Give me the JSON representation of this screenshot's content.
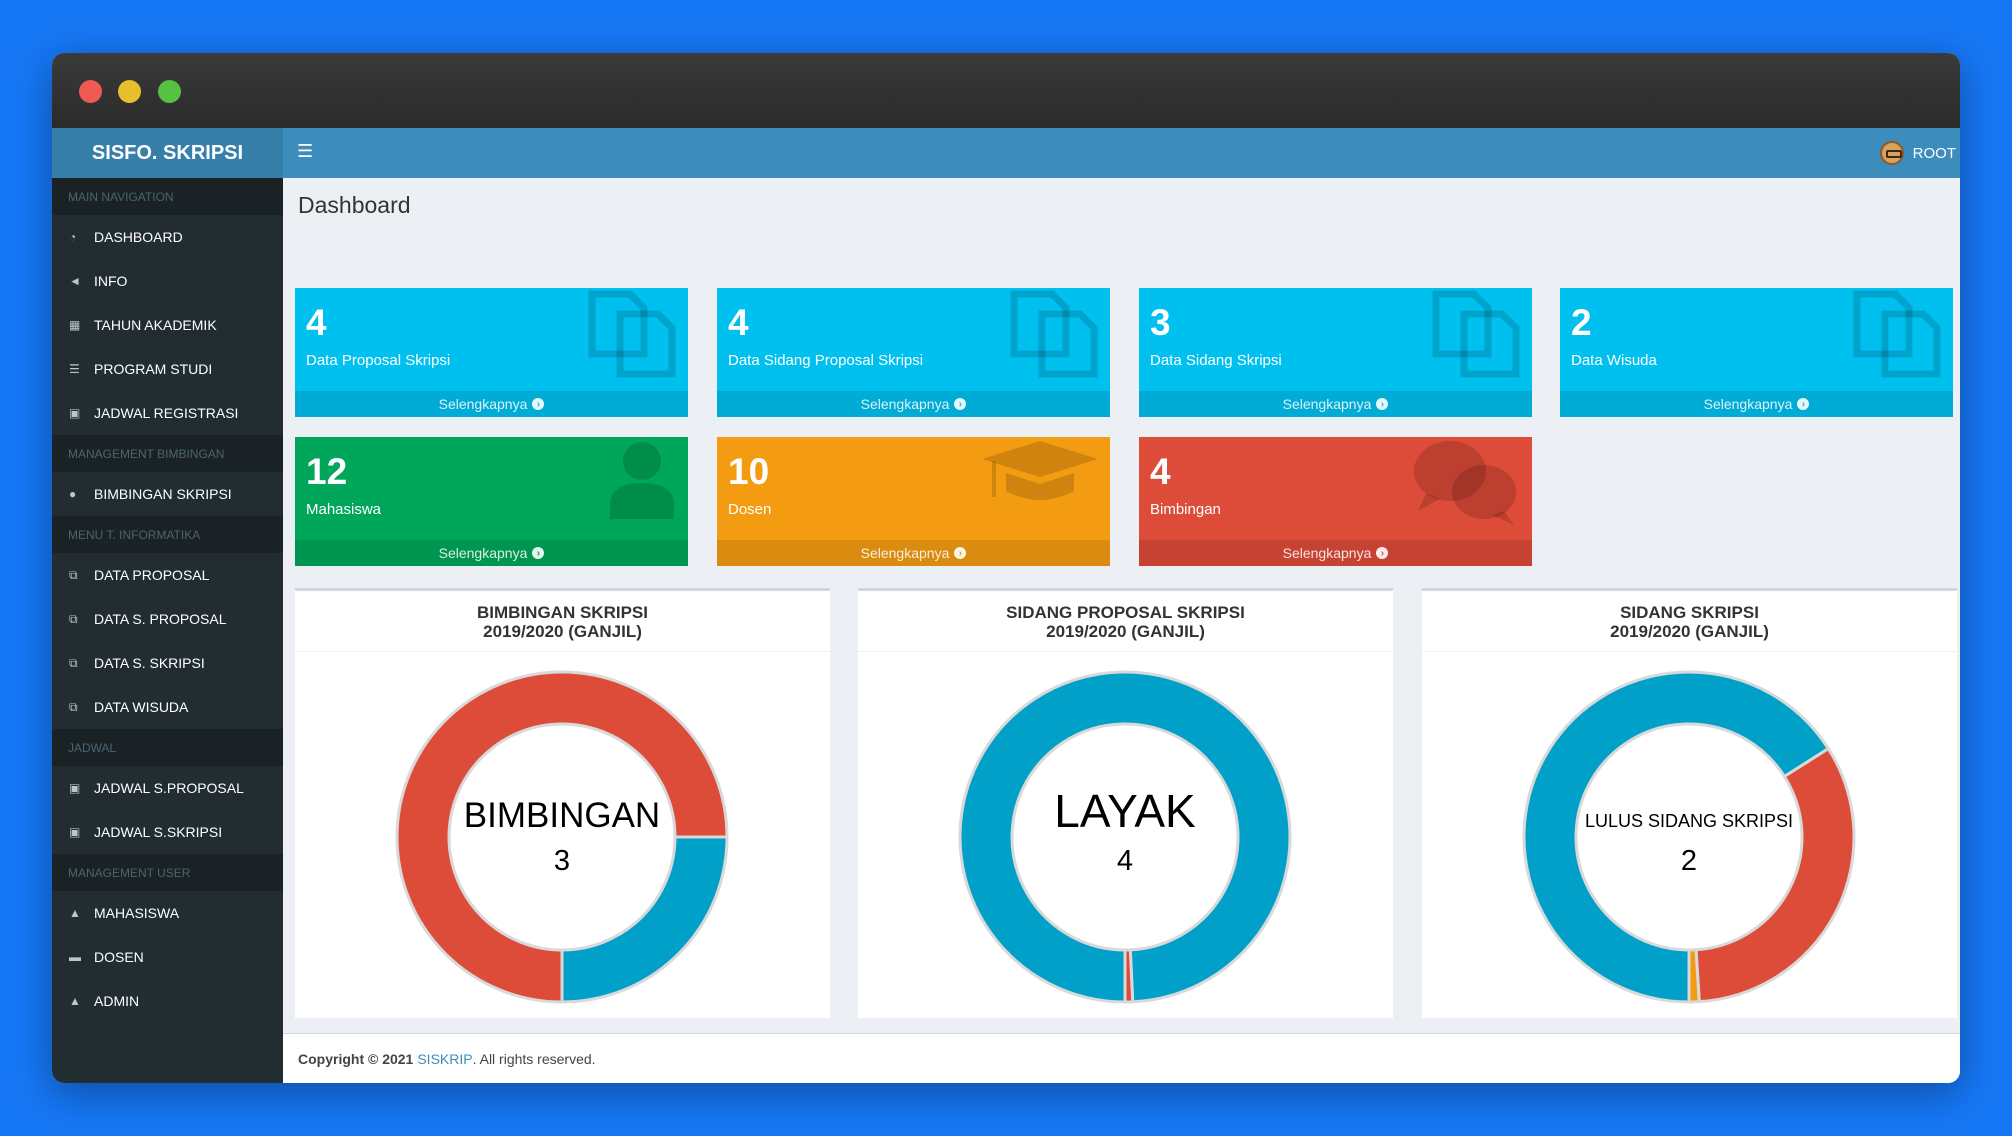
{
  "brand": "SISFO. SKRIPSI",
  "user": "ROOT",
  "page_title": "Dashboard",
  "sidebar": {
    "sections": [
      {
        "header": "MAIN NAVIGATION",
        "items": [
          {
            "label": "DASHBOARD",
            "icon": "dashboard-icon"
          },
          {
            "label": "INFO",
            "icon": "bullhorn-icon"
          },
          {
            "label": "TAHUN AKADEMIK",
            "icon": "calendar-icon"
          },
          {
            "label": "PROGRAM STUDI",
            "icon": "list-icon"
          },
          {
            "label": "JADWAL REGISTRASI",
            "icon": "calendar-plus-icon"
          }
        ]
      },
      {
        "header": "MANAGEMENT BIMBINGAN",
        "items": [
          {
            "label": "BIMBINGAN SKRIPSI",
            "icon": "comments-icon"
          }
        ]
      },
      {
        "header": "MENU T. INFORMATIKA",
        "items": [
          {
            "label": "DATA PROPOSAL",
            "icon": "copy-icon"
          },
          {
            "label": "DATA S. PROPOSAL",
            "icon": "copy-icon"
          },
          {
            "label": "DATA S. SKRIPSI",
            "icon": "copy-icon"
          },
          {
            "label": "DATA WISUDA",
            "icon": "copy-icon"
          }
        ]
      },
      {
        "header": "JADWAL",
        "items": [
          {
            "label": "JADWAL S.PROPOSAL",
            "icon": "calendar-plus-icon"
          },
          {
            "label": "JADWAL S.SKRIPSI",
            "icon": "calendar-plus-icon"
          }
        ]
      },
      {
        "header": "MANAGEMENT USER",
        "items": [
          {
            "label": "MAHASISWA",
            "icon": "user-icon"
          },
          {
            "label": "DOSEN",
            "icon": "graduation-cap-icon"
          },
          {
            "label": "ADMIN",
            "icon": "user-secret-icon"
          }
        ]
      }
    ]
  },
  "boxes": [
    {
      "value": "4",
      "label": "Data Proposal Skripsi",
      "more": "Selengkapnya",
      "color": "#00c0ef",
      "icon": "copy-icon"
    },
    {
      "value": "4",
      "label": "Data Sidang Proposal Skripsi",
      "more": "Selengkapnya",
      "color": "#00c0ef",
      "icon": "copy-icon"
    },
    {
      "value": "3",
      "label": "Data Sidang Skripsi",
      "more": "Selengkapnya",
      "color": "#00c0ef",
      "icon": "copy-icon"
    },
    {
      "value": "2",
      "label": "Data Wisuda",
      "more": "Selengkapnya",
      "color": "#00c0ef",
      "icon": "copy-icon"
    },
    {
      "value": "12",
      "label": "Mahasiswa",
      "more": "Selengkapnya",
      "color": "#00a65a",
      "icon": "user-icon"
    },
    {
      "value": "10",
      "label": "Dosen",
      "more": "Selengkapnya",
      "color": "#f39c12",
      "icon": "graduation-cap-icon"
    },
    {
      "value": "4",
      "label": "Bimbingan",
      "more": "Selengkapnya",
      "color": "#dd4b39",
      "icon": "comments-icon"
    }
  ],
  "chart_data": [
    {
      "type": "pie",
      "title_line1": "BIMBINGAN SKRIPSI",
      "title_line2": "2019/2020 (GANJIL)",
      "center_label": "BIMBINGAN",
      "center_value": "3",
      "slices": [
        {
          "value": 3,
          "color": "#dd4b39"
        },
        {
          "value": 1,
          "color": "#00a0c8"
        }
      ]
    },
    {
      "type": "pie",
      "title_line1": "SIDANG PROPOSAL SKRIPSI",
      "title_line2": "2019/2020 (GANJIL)",
      "center_label": "LAYAK",
      "center_value": "4",
      "slices": [
        {
          "value": 4,
          "color": "#00a0c8"
        },
        {
          "value": 0.03,
          "color": "#dd4b39"
        }
      ]
    },
    {
      "type": "pie",
      "title_line1": "SIDANG SKRIPSI",
      "title_line2": "2019/2020 (GANJIL)",
      "center_label": "LULUS SIDANG SKRIPSI",
      "center_value": "2",
      "slices": [
        {
          "value": 2,
          "color": "#00a0c8"
        },
        {
          "value": 1,
          "color": "#dd4b39"
        },
        {
          "value": 0.03,
          "color": "#f39c12"
        }
      ]
    }
  ],
  "footer": {
    "copyright": "Copyright © 2021",
    "brand": "SISKRIP",
    "rest": ". All rights reserved."
  }
}
